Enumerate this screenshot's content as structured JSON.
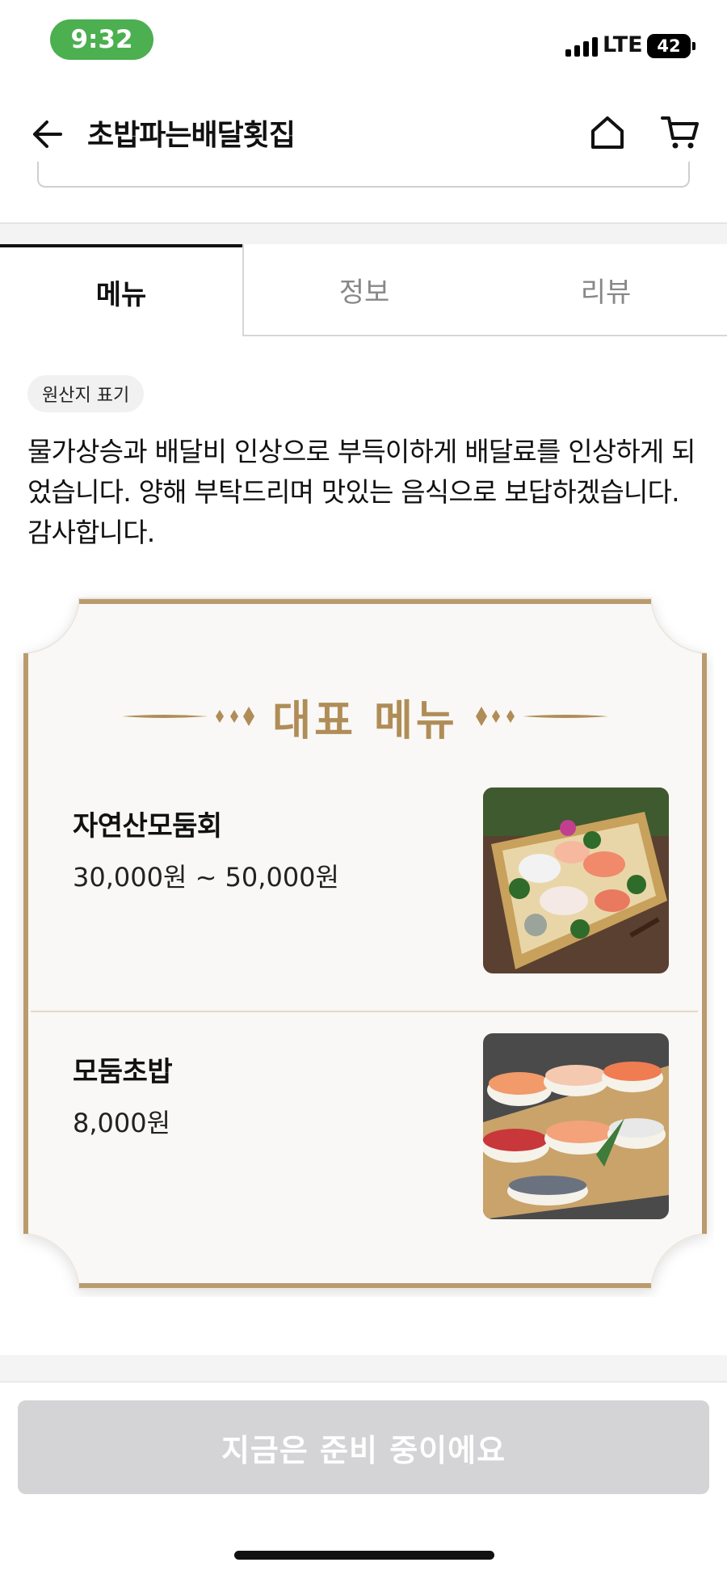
{
  "status_bar": {
    "time": "9:32",
    "network": "LTE",
    "battery": "42"
  },
  "nav": {
    "title": "초밥파는배달횟집",
    "back_icon": "arrow-left-icon",
    "home_icon": "home-icon",
    "cart_icon": "cart-icon"
  },
  "tabs": [
    {
      "label": "메뉴",
      "active": true
    },
    {
      "label": "정보",
      "active": false
    },
    {
      "label": "리뷰",
      "active": false
    }
  ],
  "origin_chip": "원산지 표기",
  "notice": "물가상승과 배달비 인상으로 부득이하게 배달료를 인상하게 되었습니다. 양해 부탁드리며 맛있는 음식으로 보답하겠습니다. 감사합니다.",
  "featured": {
    "title": "대표 메뉴",
    "accent_color": "#b08d57",
    "items": [
      {
        "name": "자연산모둠회",
        "price": "30,000원 ~ 50,000원",
        "photo": "sashimi-platter-photo"
      },
      {
        "name": "모둠초밥",
        "price": "8,000원",
        "photo": "sushi-platter-photo"
      }
    ]
  },
  "order_button": "지금은 준비 중이에요"
}
